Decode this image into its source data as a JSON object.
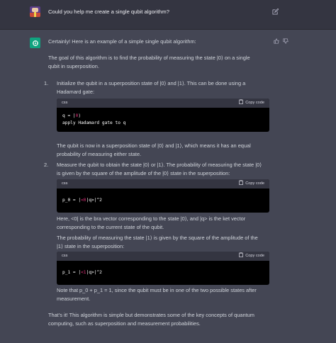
{
  "user_prompt": "Could you help me create a single qubit algorithm?",
  "response": {
    "intro": "Certainly! Here is an example of a simple single qubit algorithm:",
    "goal": [
      "The goal of this algorithm is to find the probability of measuring the state |0⟩ on a single",
      "qubit in superposition."
    ],
    "step1_num": "1.",
    "step1": [
      "Initialize the qubit in a superposition state of |0⟩ and |1⟩. This can be done using a",
      "Hadamard gate:"
    ],
    "code1": {
      "lang": "css",
      "copy": "Copy code",
      "line1_pre": "q = |",
      "line1_kw": "0",
      "line1_post": "⟩",
      "line2": "apply Hadamard gate to q"
    },
    "after1": [
      "The qubit is now in a superposition state of |0⟩ and |1⟩, which means it has an equal",
      "probability of measuring either state."
    ],
    "step2_num": "2.",
    "step2": [
      "Measure the qubit to obtain the state |0⟩ or |1⟩. The probability of measuring the state |0⟩",
      "is given by the square of the amplitude of the |0⟩ state in the superposition:"
    ],
    "code2": {
      "lang": "css",
      "copy": "Copy code",
      "pre": "p_0 = |",
      "kw": "<0",
      "post": "|q>|^2"
    },
    "after2": [
      "Here, <0| is the bra vector corresponding to the state |0⟩, and |q> is the ket vector",
      "corresponding to the current state of the qubit.",
      "The probability of measuring the state |1⟩ is given by the square of the amplitude of the",
      "|1⟩ state in the superposition:"
    ],
    "code3": {
      "lang": "css",
      "copy": "Copy code",
      "pre": "p_1 = |",
      "kw": "<1",
      "post": "|q>|^2"
    },
    "note": [
      "Note that p_0 + p_1 = 1, since the qubit must be in one of the two possible states after",
      "measurement."
    ],
    "closing": [
      "That's it! This algorithm is simple but demonstrates some of the key concepts of quantum",
      "computing, such as superposition and measurement probabilities."
    ]
  },
  "colors": {
    "user_bg": "#343541",
    "bot_bg": "#444654",
    "accent": "#10a37f",
    "code_keyword": "#df3079"
  },
  "icons": [
    "edit-icon",
    "openai-logo-icon",
    "thumbs-up-icon",
    "thumbs-down-icon",
    "clipboard-icon"
  ]
}
